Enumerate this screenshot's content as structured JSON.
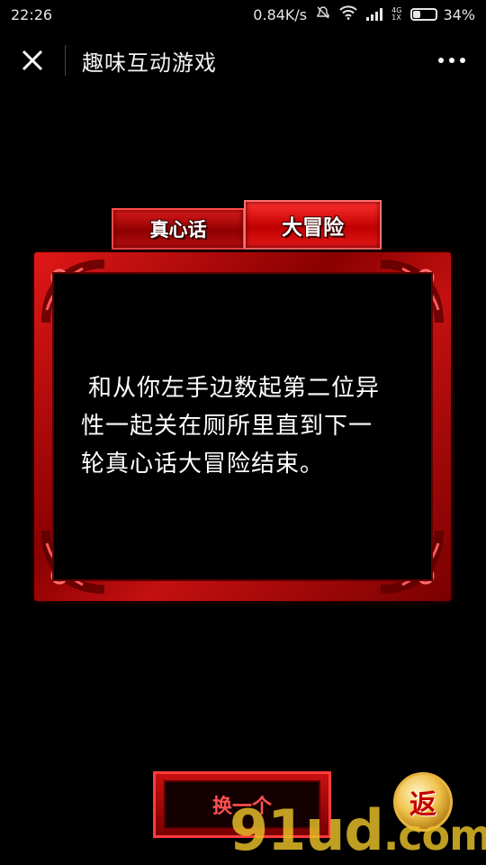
{
  "status_bar": {
    "time": "22:26",
    "net_speed": "0.84K/s",
    "net_gen_top": "4G",
    "net_gen_bottom": "1X",
    "battery": "34%",
    "battery_level": 0.34
  },
  "header": {
    "title": "趣味互动游戏"
  },
  "tabs": [
    {
      "label": "真心话",
      "selected": false
    },
    {
      "label": "大冒险",
      "selected": true
    }
  ],
  "card": {
    "text": "和从你左手边数起第二位异性一起关在厕所里直到下一轮真心话大冒险结束。"
  },
  "buttons": {
    "change_label": "换一个",
    "back_label": "返"
  },
  "watermark": {
    "text": "91ud",
    "suffix": ".com"
  }
}
